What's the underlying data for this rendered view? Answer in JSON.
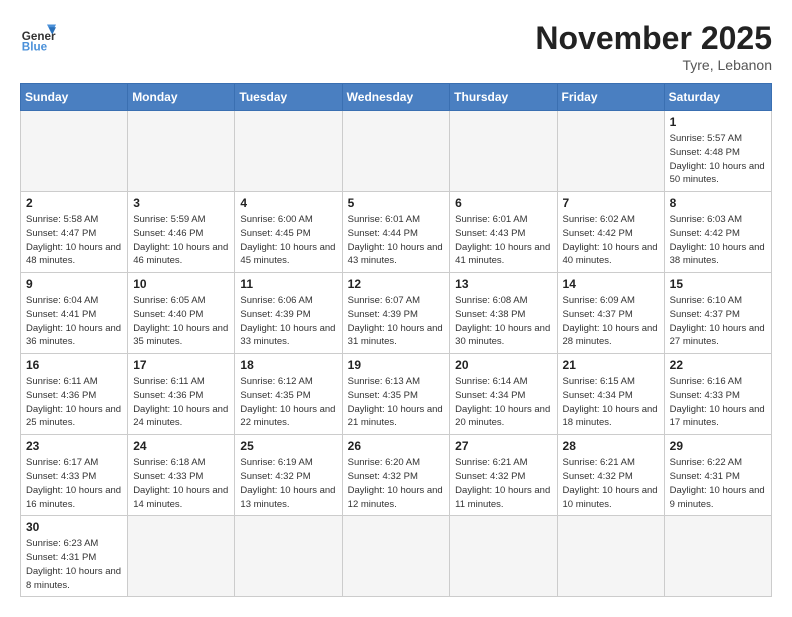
{
  "header": {
    "logo_general": "General",
    "logo_blue": "Blue",
    "month": "November 2025",
    "location": "Tyre, Lebanon"
  },
  "weekdays": [
    "Sunday",
    "Monday",
    "Tuesday",
    "Wednesday",
    "Thursday",
    "Friday",
    "Saturday"
  ],
  "days": [
    {
      "num": "",
      "empty": true
    },
    {
      "num": "",
      "empty": true
    },
    {
      "num": "",
      "empty": true
    },
    {
      "num": "",
      "empty": true
    },
    {
      "num": "",
      "empty": true
    },
    {
      "num": "",
      "empty": true
    },
    {
      "num": "1",
      "sunrise": "5:57 AM",
      "sunset": "4:48 PM",
      "daylight": "10 hours and 50 minutes."
    },
    {
      "num": "2",
      "sunrise": "5:58 AM",
      "sunset": "4:47 PM",
      "daylight": "10 hours and 48 minutes."
    },
    {
      "num": "3",
      "sunrise": "5:59 AM",
      "sunset": "4:46 PM",
      "daylight": "10 hours and 46 minutes."
    },
    {
      "num": "4",
      "sunrise": "6:00 AM",
      "sunset": "4:45 PM",
      "daylight": "10 hours and 45 minutes."
    },
    {
      "num": "5",
      "sunrise": "6:01 AM",
      "sunset": "4:44 PM",
      "daylight": "10 hours and 43 minutes."
    },
    {
      "num": "6",
      "sunrise": "6:01 AM",
      "sunset": "4:43 PM",
      "daylight": "10 hours and 41 minutes."
    },
    {
      "num": "7",
      "sunrise": "6:02 AM",
      "sunset": "4:42 PM",
      "daylight": "10 hours and 40 minutes."
    },
    {
      "num": "8",
      "sunrise": "6:03 AM",
      "sunset": "4:42 PM",
      "daylight": "10 hours and 38 minutes."
    },
    {
      "num": "9",
      "sunrise": "6:04 AM",
      "sunset": "4:41 PM",
      "daylight": "10 hours and 36 minutes."
    },
    {
      "num": "10",
      "sunrise": "6:05 AM",
      "sunset": "4:40 PM",
      "daylight": "10 hours and 35 minutes."
    },
    {
      "num": "11",
      "sunrise": "6:06 AM",
      "sunset": "4:39 PM",
      "daylight": "10 hours and 33 minutes."
    },
    {
      "num": "12",
      "sunrise": "6:07 AM",
      "sunset": "4:39 PM",
      "daylight": "10 hours and 31 minutes."
    },
    {
      "num": "13",
      "sunrise": "6:08 AM",
      "sunset": "4:38 PM",
      "daylight": "10 hours and 30 minutes."
    },
    {
      "num": "14",
      "sunrise": "6:09 AM",
      "sunset": "4:37 PM",
      "daylight": "10 hours and 28 minutes."
    },
    {
      "num": "15",
      "sunrise": "6:10 AM",
      "sunset": "4:37 PM",
      "daylight": "10 hours and 27 minutes."
    },
    {
      "num": "16",
      "sunrise": "6:11 AM",
      "sunset": "4:36 PM",
      "daylight": "10 hours and 25 minutes."
    },
    {
      "num": "17",
      "sunrise": "6:11 AM",
      "sunset": "4:36 PM",
      "daylight": "10 hours and 24 minutes."
    },
    {
      "num": "18",
      "sunrise": "6:12 AM",
      "sunset": "4:35 PM",
      "daylight": "10 hours and 22 minutes."
    },
    {
      "num": "19",
      "sunrise": "6:13 AM",
      "sunset": "4:35 PM",
      "daylight": "10 hours and 21 minutes."
    },
    {
      "num": "20",
      "sunrise": "6:14 AM",
      "sunset": "4:34 PM",
      "daylight": "10 hours and 20 minutes."
    },
    {
      "num": "21",
      "sunrise": "6:15 AM",
      "sunset": "4:34 PM",
      "daylight": "10 hours and 18 minutes."
    },
    {
      "num": "22",
      "sunrise": "6:16 AM",
      "sunset": "4:33 PM",
      "daylight": "10 hours and 17 minutes."
    },
    {
      "num": "23",
      "sunrise": "6:17 AM",
      "sunset": "4:33 PM",
      "daylight": "10 hours and 16 minutes."
    },
    {
      "num": "24",
      "sunrise": "6:18 AM",
      "sunset": "4:33 PM",
      "daylight": "10 hours and 14 minutes."
    },
    {
      "num": "25",
      "sunrise": "6:19 AM",
      "sunset": "4:32 PM",
      "daylight": "10 hours and 13 minutes."
    },
    {
      "num": "26",
      "sunrise": "6:20 AM",
      "sunset": "4:32 PM",
      "daylight": "10 hours and 12 minutes."
    },
    {
      "num": "27",
      "sunrise": "6:21 AM",
      "sunset": "4:32 PM",
      "daylight": "10 hours and 11 minutes."
    },
    {
      "num": "28",
      "sunrise": "6:21 AM",
      "sunset": "4:32 PM",
      "daylight": "10 hours and 10 minutes."
    },
    {
      "num": "29",
      "sunrise": "6:22 AM",
      "sunset": "4:31 PM",
      "daylight": "10 hours and 9 minutes."
    },
    {
      "num": "30",
      "sunrise": "6:23 AM",
      "sunset": "4:31 PM",
      "daylight": "10 hours and 8 minutes."
    },
    {
      "num": "",
      "empty": true
    },
    {
      "num": "",
      "empty": true
    },
    {
      "num": "",
      "empty": true
    },
    {
      "num": "",
      "empty": true
    },
    {
      "num": "",
      "empty": true
    },
    {
      "num": "",
      "empty": true
    }
  ]
}
